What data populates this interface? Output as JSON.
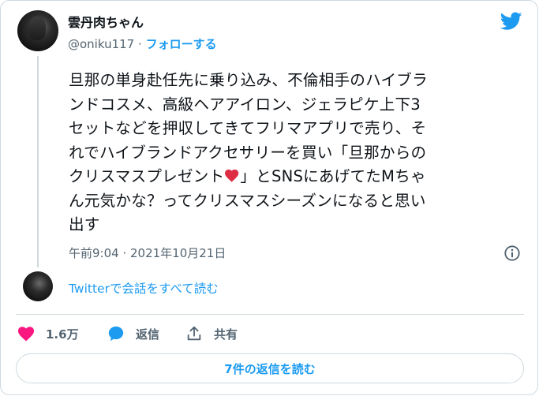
{
  "colors": {
    "accent": "#1d9bf0",
    "like": "#f91880",
    "muted": "#536471",
    "text": "#0f1419",
    "border": "#cfd9de"
  },
  "user": {
    "display_name": "雲丹肉ちゃん",
    "handle": "@oniku117",
    "separator": "·",
    "follow_label": "フォローする"
  },
  "tweet": {
    "lines": [
      "旦那の単身赴任先に乗り込み、不倫相手のハイブラ",
      "ンドコスメ、高級ヘアアイロン、ジェラピケ上下3",
      "セットなどを押収してきてフリマアプリで売り、そ",
      "れでハイブランドアクセサリーを買い「旦那からの"
    ],
    "line5_before": "クリスマスプレゼント",
    "emoji": "heart-emoji",
    "line5_after": "」とSNSにあげてたMちゃ",
    "lines_after": [
      "ん元気かな？ってクリスマスシーズンになると思い",
      "出す"
    ],
    "timestamp": "午前9:04 · 2021年10月21日"
  },
  "conversation": {
    "read_label": "Twitterで会話をすべて読む"
  },
  "actions": {
    "like_count": "1.6万",
    "reply_label": "返信",
    "share_label": "共有"
  },
  "replies": {
    "button_label": "7件の返信を読む"
  },
  "icons": [
    "twitter-bird-icon",
    "info-icon",
    "heart-icon",
    "reply-bubble-icon",
    "share-icon"
  ]
}
